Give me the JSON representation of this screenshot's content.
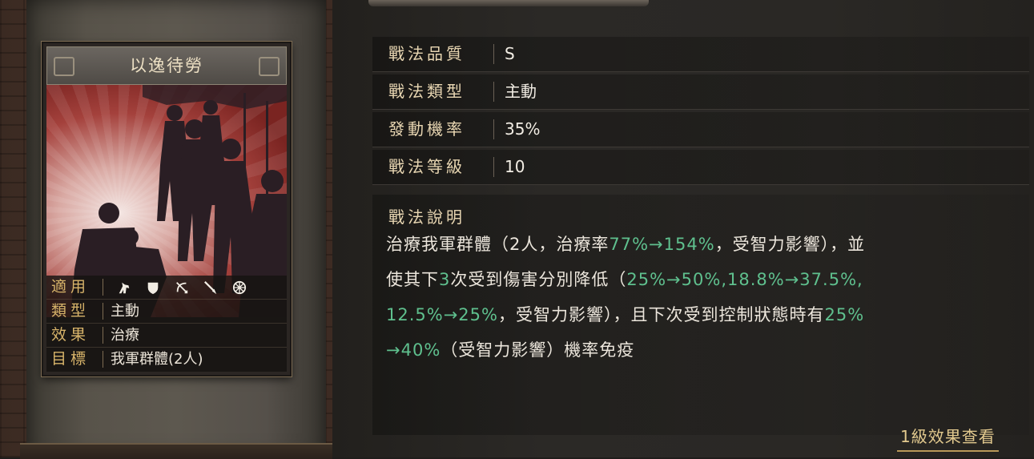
{
  "card": {
    "title": "以逸待勞",
    "attributes": [
      {
        "key": "適用",
        "value": ""
      },
      {
        "key": "類型",
        "value": "主動"
      },
      {
        "key": "效果",
        "value": "治療"
      },
      {
        "key": "目標",
        "value": "我軍群體(2人)"
      }
    ],
    "troop_icons": [
      "cavalry-horse-icon",
      "shield-infantry-icon",
      "archer-bow-icon",
      "spear-icon",
      "siege-wheel-icon"
    ]
  },
  "info": {
    "rows": [
      {
        "label": "戰法品質",
        "value": "S"
      },
      {
        "label": "戰法類型",
        "value": "主動"
      },
      {
        "label": "發動機率",
        "value": "35%"
      },
      {
        "label": "戰法等級",
        "value": "10"
      }
    ]
  },
  "description": {
    "title": "戰法說明",
    "lines": [
      [
        {
          "t": "治療我軍群體（2人，治療率"
        },
        {
          "t": "77%→154%",
          "hl": true
        },
        {
          "t": "，受智力影響），並"
        }
      ],
      [
        {
          "t": "使其下"
        },
        {
          "t": "3",
          "hl": true
        },
        {
          "t": "次受到傷害分別降低（"
        },
        {
          "t": "25%→50%,18.8%→37.5%,",
          "hl": true
        }
      ],
      [
        {
          "t": "12.5%→25%",
          "hl": true
        },
        {
          "t": "，受智力影響），且下次受到控制狀態時有"
        },
        {
          "t": "25%",
          "hl": true
        }
      ],
      [
        {
          "t": "→40%",
          "hl": true
        },
        {
          "t": "（受智力影響）機率免疫"
        }
      ]
    ],
    "highlight_color": "#5fc08e"
  },
  "more_link": "1級效果查看"
}
